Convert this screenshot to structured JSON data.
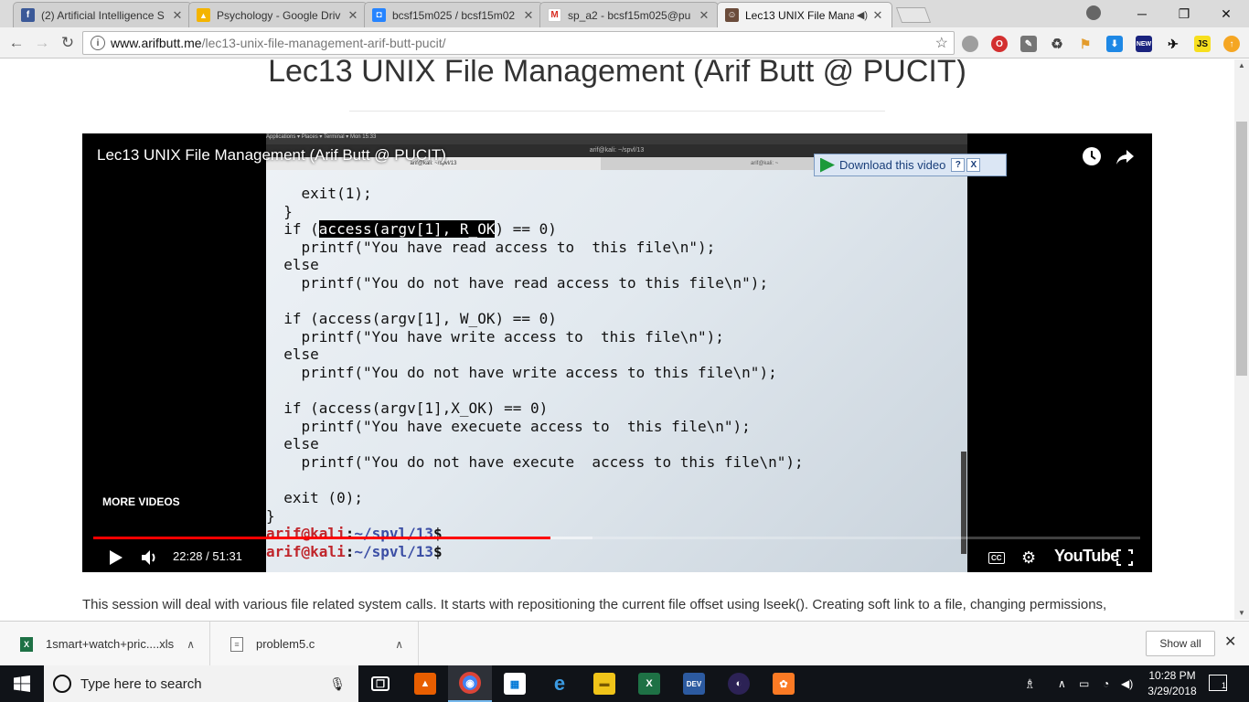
{
  "browser": {
    "tabs": [
      {
        "title": "(2) Artificial Intelligence S",
        "favicon": "facebook-icon",
        "color": "#3b5998",
        "glyph": "f"
      },
      {
        "title": "Psychology - Google Driv",
        "favicon": "google-drive-icon",
        "color": "#f4b400",
        "glyph": "▲"
      },
      {
        "title": "bcsf15m025 / bcsf15m02",
        "favicon": "bitbucket-icon",
        "color": "#2684ff",
        "glyph": "◘"
      },
      {
        "title": "sp_a2 - bcsf15m025@pu",
        "favicon": "gmail-icon",
        "color": "#d93025",
        "glyph": "M"
      },
      {
        "title": "Lec13 UNIX File Mana",
        "favicon": "site-avatar-icon",
        "color": "#6b4c3b",
        "glyph": "☺"
      }
    ],
    "window_controls": {
      "minimize": "─",
      "maximize": "❐",
      "close": "✕"
    },
    "url_host": "www.arifbutt.me",
    "url_path": "/lec13-unix-file-management-arif-butt-pucit/",
    "extensions": [
      "ext-gray",
      "ext-red",
      "ext-tools",
      "ext-recycle",
      "ext-flag",
      "ext-download",
      "ext-new",
      "ext-bird",
      "ext-js",
      "ext-update"
    ]
  },
  "page": {
    "title": "Lec13 UNIX File Management (Arif Butt @ PUCIT)",
    "description": "This session will deal with various file related system calls. It starts with repositioning the current file offset using lseek(). Creating soft link to a file, changing permissions,"
  },
  "video": {
    "title": "Lec13 UNIX File Management (Arif Butt @ PUCIT)",
    "download_label": "Download this video",
    "download_help": "?",
    "download_close": "X",
    "more_videos": "MORE VIDEOS",
    "time": "22:28 / 51:31",
    "played_fraction": 0.437,
    "buffered_fraction": 0.477,
    "youtube_label": "YouTube",
    "cc_label": "CC",
    "terminal": {
      "window_title": "arif@kali: ~/spvl/13",
      "tab1": "arif@kali: ~/spvl/13",
      "tab2": "arif@kali: ~",
      "topbar": "Applications ▾   Places ▾   Terminal ▾                                  Mon 15:33",
      "code": {
        "l1": "    exit(1);",
        "l2": "  }",
        "l3_pre": "  if (",
        "l3_hl": "access(argv[1], R_OK",
        "l3_post": ") == 0)",
        "l4": "    printf(\"You have read access to  this file\\n\");",
        "l5": "  else",
        "l6": "    printf(\"You do not have read access to this file\\n\");",
        "l7": "",
        "l8": "  if (access(argv[1], W_OK) == 0)",
        "l9": "    printf(\"You have write access to  this file\\n\");",
        "l10": "  else",
        "l11": "    printf(\"You do not have write access to this file\\n\");",
        "l12": "",
        "l13": "  if (access(argv[1],X_OK) == 0)",
        "l14": "    printf(\"You have execuete access to  this file\\n\");",
        "l15": "  else",
        "l16": "    printf(\"You do not have execute  access to this file\\n\");",
        "l17": "",
        "l18": "  exit (0);",
        "l19": "}"
      },
      "prompt_user": "arif@kali",
      "prompt_colon": ":",
      "prompt_path": "~/spvl/13",
      "prompt_dollar": "$"
    }
  },
  "downloads": [
    {
      "name": "1smart+watch+pric....xls",
      "icon": "excel-file-icon"
    },
    {
      "name": "problem5.c",
      "icon": "text-file-icon"
    }
  ],
  "show_all_label": "Show all",
  "taskbar": {
    "search_placeholder": "Type here to search",
    "time": "10:28 PM",
    "date": "3/29/2018",
    "notif_count": "1",
    "apps": [
      {
        "name": "task-view-icon",
        "color": "#101318",
        "glyph": "❐"
      },
      {
        "name": "vlc-icon",
        "color": "#e85e00",
        "glyph": "▲"
      },
      {
        "name": "chrome-icon",
        "color": "#4285f4",
        "glyph": "◉"
      },
      {
        "name": "store-icon",
        "color": "#0078d7",
        "glyph": "▦"
      },
      {
        "name": "edge-icon",
        "color": "#0a7dd8",
        "glyph": "e"
      },
      {
        "name": "file-explorer-icon",
        "color": "#f0c419",
        "glyph": "▬"
      },
      {
        "name": "excel-icon",
        "color": "#1e7145",
        "glyph": "X"
      },
      {
        "name": "devcpp-icon",
        "color": "#2c5aa0",
        "glyph": "DEV"
      },
      {
        "name": "eclipse-icon",
        "color": "#2c2255",
        "glyph": "◐"
      },
      {
        "name": "xampp-icon",
        "color": "#fb7a24",
        "glyph": "✿"
      }
    ]
  }
}
